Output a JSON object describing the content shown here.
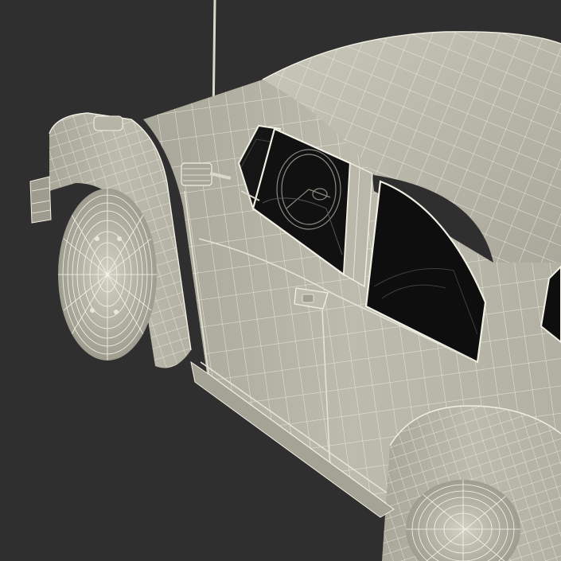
{
  "scene": {
    "background_color": "#2f2f2f",
    "body_color": "#bdbcad",
    "wire_color": "#f1f0e4",
    "glass_color": "#0f0f0f",
    "interior_color": "#3a3a3a",
    "shadow_color": "#8e8d80"
  }
}
